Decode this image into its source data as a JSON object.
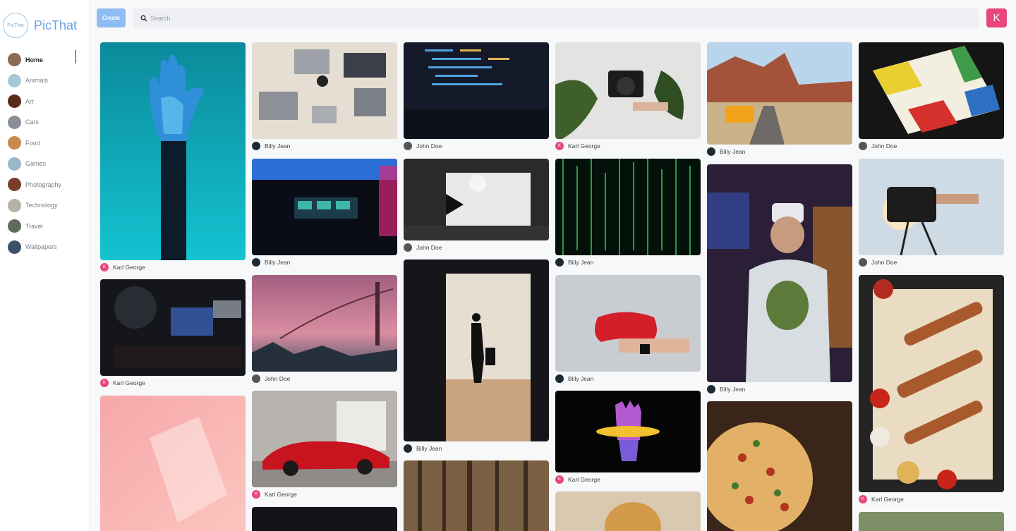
{
  "app": {
    "name": "PicThat",
    "logo_text": "PicThat"
  },
  "sidebar": {
    "items": [
      {
        "label": "Home",
        "active": true,
        "color": "#8a6a55"
      },
      {
        "label": "Animals",
        "active": false,
        "color": "#a7c8d6"
      },
      {
        "label": "Art",
        "active": false,
        "color": "#5a2a1a"
      },
      {
        "label": "Cars",
        "active": false,
        "color": "#8b8f99"
      },
      {
        "label": "Food",
        "active": false,
        "color": "#c98b4a"
      },
      {
        "label": "Games",
        "active": false,
        "color": "#9ab8c9"
      },
      {
        "label": "Photography",
        "active": false,
        "color": "#7a3e2a"
      },
      {
        "label": "Technology",
        "active": false,
        "color": "#b7b2a6"
      },
      {
        "label": "Travel",
        "active": false,
        "color": "#5e6b5a"
      },
      {
        "label": "Wallpapers",
        "active": false,
        "color": "#3b5266"
      }
    ]
  },
  "topbar": {
    "create_label": "Create",
    "search_placeholder": "Search",
    "user_initial": "K"
  },
  "pins": [
    {
      "author": "Karl George",
      "avatar": "K",
      "avatar_color": "#e94680",
      "image": "robot-hand-teal"
    },
    {
      "author": "Karl George",
      "avatar": "K",
      "avatar_color": "#e94680",
      "image": "gamer-dark-room"
    },
    {
      "author": "",
      "avatar": "",
      "avatar_color": "",
      "image": "pink-abstract"
    },
    {
      "author": "Billy Jean",
      "avatar": "",
      "avatar_color": "#1d2a33",
      "image": "desk-laptops"
    },
    {
      "author": "Billy Jean",
      "avatar": "",
      "avatar_color": "#1d2a33",
      "image": "arcade-room"
    },
    {
      "author": "John Doe",
      "avatar": "",
      "avatar_color": "#555555",
      "image": "foggy-bridge"
    },
    {
      "author": "Karl George",
      "avatar": "K",
      "avatar_color": "#e94680",
      "image": "red-ferrari"
    },
    {
      "author": "",
      "avatar": "",
      "avatar_color": "",
      "image": "dark-partial"
    },
    {
      "author": "John Doe",
      "avatar": "",
      "avatar_color": "#555555",
      "image": "code-screen"
    },
    {
      "author": "John Doe",
      "avatar": "",
      "avatar_color": "#555555",
      "image": "photo-studio"
    },
    {
      "author": "Billy Jean",
      "avatar": "",
      "avatar_color": "#1d2a33",
      "image": "airport-silhouette"
    },
    {
      "author": "",
      "avatar": "",
      "avatar_color": "",
      "image": "forest"
    },
    {
      "author": "Karl George",
      "avatar": "K",
      "avatar_color": "#e94680",
      "image": "camera-plant"
    },
    {
      "author": "Billy Jean",
      "avatar": "",
      "avatar_color": "#1d2a33",
      "image": "matrix-code"
    },
    {
      "author": "Billy Jean",
      "avatar": "",
      "avatar_color": "#1d2a33",
      "image": "red-gamepad"
    },
    {
      "author": "Karl George",
      "avatar": "K",
      "avatar_color": "#e94680",
      "image": "neon-hand"
    },
    {
      "author": "",
      "avatar": "",
      "avatar_color": "",
      "image": "golden-hair"
    },
    {
      "author": "Billy Jean",
      "avatar": "",
      "avatar_color": "#1d2a33",
      "image": "desert-van"
    },
    {
      "author": "Billy Jean",
      "avatar": "",
      "avatar_color": "#1d2a33",
      "image": "vr-boy"
    },
    {
      "author": "",
      "avatar": "",
      "avatar_color": "",
      "image": "pizza"
    },
    {
      "author": "John Doe",
      "avatar": "",
      "avatar_color": "#555555",
      "image": "ludo-board"
    },
    {
      "author": "John Doe",
      "avatar": "",
      "avatar_color": "#555555",
      "image": "camera-sun"
    },
    {
      "author": "Karl George",
      "avatar": "K",
      "avatar_color": "#e94680",
      "image": "bbq-platter"
    },
    {
      "author": "",
      "avatar": "",
      "avatar_color": "",
      "image": "green-partial"
    }
  ]
}
